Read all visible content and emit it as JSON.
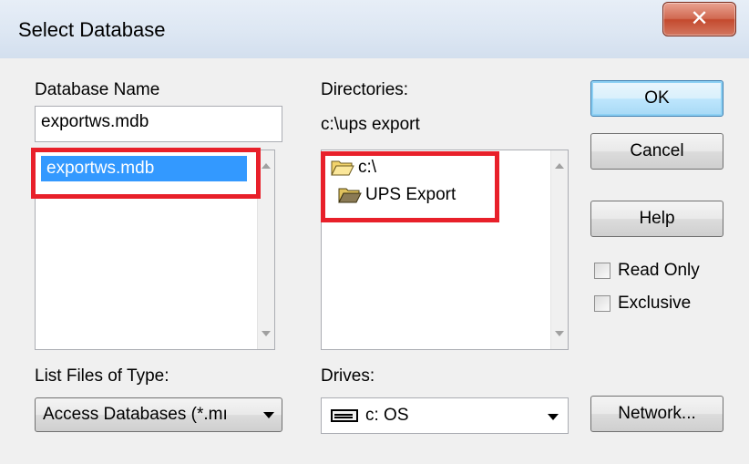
{
  "window": {
    "title": "Select Database",
    "close_glyph": "✕"
  },
  "database": {
    "label": "Database Name",
    "value": "exportws.mdb",
    "files": [
      "exportws.mdb"
    ]
  },
  "directories": {
    "label": "Directories:",
    "current_path": "c:\\ups export",
    "tree": [
      "c:\\",
      "UPS Export"
    ]
  },
  "file_type": {
    "label": "List Files of Type:",
    "selected": "Access Databases (*.mı"
  },
  "drives": {
    "label": "Drives:",
    "selected": "c: OS"
  },
  "buttons": {
    "ok": "OK",
    "cancel": "Cancel",
    "help": "Help",
    "network": "Network..."
  },
  "options": {
    "read_only": "Read Only",
    "exclusive": "Exclusive"
  },
  "colors": {
    "highlight": "#e8202a",
    "selection": "#3399ff",
    "close_button": "#c44a2e"
  },
  "icons": {
    "close": "close-icon",
    "folder_open": "folder-open-icon",
    "drive": "hard-drive-icon",
    "dropdown": "chevron-down-icon"
  }
}
